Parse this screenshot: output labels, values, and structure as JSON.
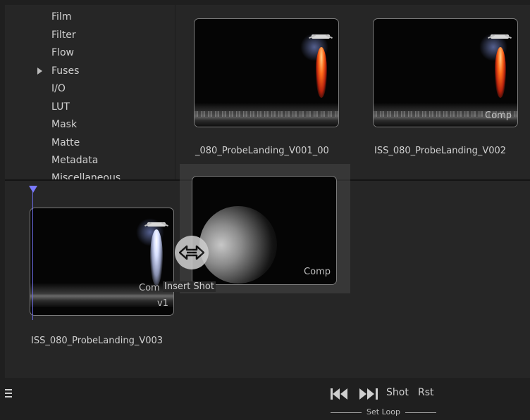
{
  "bin_tree": {
    "items": [
      {
        "label": "Film",
        "expandable": false
      },
      {
        "label": "Filter",
        "expandable": false
      },
      {
        "label": "Flow",
        "expandable": false
      },
      {
        "label": "Fuses",
        "expandable": true
      },
      {
        "label": "I/O",
        "expandable": false
      },
      {
        "label": "LUT",
        "expandable": false
      },
      {
        "label": "Mask",
        "expandable": false
      },
      {
        "label": "Matte",
        "expandable": false
      },
      {
        "label": "Metadata",
        "expandable": false
      },
      {
        "label": "Miscellaneous",
        "expandable": false
      }
    ]
  },
  "bin_clips": [
    {
      "label": "_080_ProbeLanding_V001_00",
      "badge": ""
    },
    {
      "label": "ISS_080_ProbeLanding_V002",
      "badge": "Comp"
    }
  ],
  "timeline": {
    "clip": {
      "label": "ISS_080_ProbeLanding_V003",
      "badge": "Com",
      "version": "v1"
    },
    "dragged_clip": {
      "badge": "Comp"
    },
    "tooltip": "Insert Shot"
  },
  "bottom_bar": {
    "shot_label": "Shot",
    "reset_label": "Rst",
    "set_loop_label": "Set Loop"
  },
  "icons": [
    "menu-icon",
    "skip-back-icon",
    "skip-forward-icon",
    "swap-arrows-icon",
    "playhead-icon",
    "expand-arrow-icon"
  ],
  "colors": {
    "playhead": "#7a7aff",
    "background": "#262626"
  }
}
